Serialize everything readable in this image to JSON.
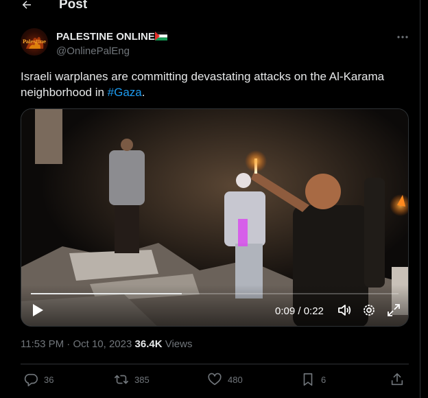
{
  "header": {
    "title": "Post"
  },
  "author": {
    "name": "PALESTINE ONLINE",
    "handle": "@OnlinePalEng",
    "avatar_text": "Palestine"
  },
  "post": {
    "text_before": "Israeli warplanes are committing devastating attacks on the Al-Karama neighborhood in ",
    "hashtag": "#Gaza",
    "text_after": "."
  },
  "video": {
    "time": "0:09 / 0:22",
    "progress": 0.41
  },
  "meta": {
    "time": "11:53 PM",
    "separator": " · ",
    "date": "Oct 10, 2023",
    "views_count": "36.4K",
    "views_label": "Views"
  },
  "actions": {
    "replies": "36",
    "reposts": "385",
    "likes": "480",
    "bookmarks": "6"
  },
  "colors": {
    "accent": "#1d9bf0",
    "background": "#000000",
    "muted": "#71767b",
    "text": "#e7e9ea"
  },
  "icons": [
    "back-arrow-icon",
    "more-icon",
    "play-icon",
    "volume-icon",
    "settings-icon",
    "fullscreen-icon",
    "reply-icon",
    "repost-icon",
    "like-icon",
    "bookmark-icon",
    "share-icon",
    "palestine-flag-icon"
  ]
}
